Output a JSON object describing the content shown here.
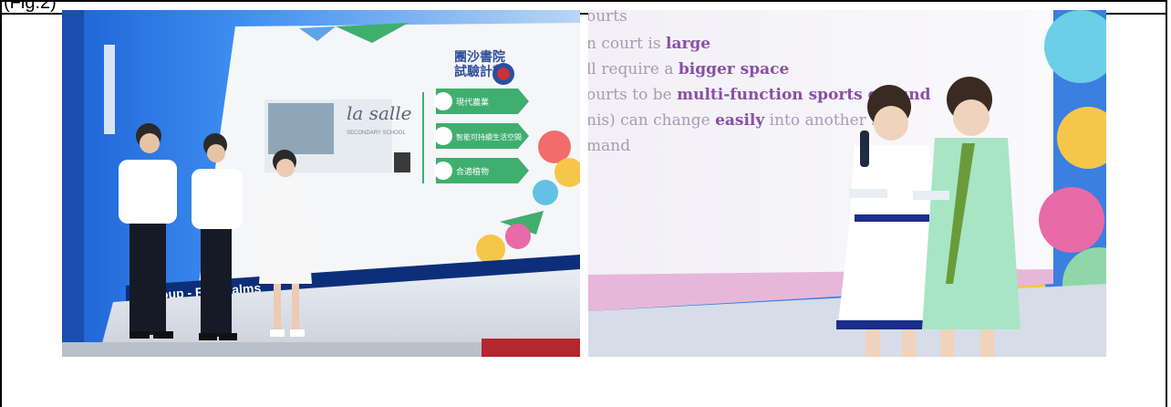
{
  "figure_label": "(Fig.2)",
  "left_photo": {
    "banner_text": "Group      - ReCo   alms",
    "slide_logo_text": "la salle",
    "slide_subtitle": "SECONDARY SCHOOL",
    "slide_heading": "團沙書院\n試驗計劃",
    "slide_items": [
      "現代農業",
      "智能可持續生活空間",
      "合適植物"
    ]
  },
  "right_photo": {
    "slide_lines": [
      {
        "before": "ourts",
        "bold": "",
        "after": ""
      },
      {
        "before": "n court is ",
        "bold": "large",
        "after": ""
      },
      {
        "before": "ll require a ",
        "bold": "bigger space",
        "after": ""
      },
      {
        "before": "ourts to be ",
        "bold": "multi-function sports ground",
        "after": ""
      },
      {
        "before": "nis) can change ",
        "bold": "easily",
        "after": " into another      s co"
      },
      {
        "before": "mand",
        "bold": "",
        "after": ""
      }
    ]
  },
  "colors": {
    "slide_green": "#3fae6f",
    "bold_purple": "#8a4fa6",
    "text_grey": "#a79bb3",
    "stage_blue": "#1d4fb8"
  }
}
